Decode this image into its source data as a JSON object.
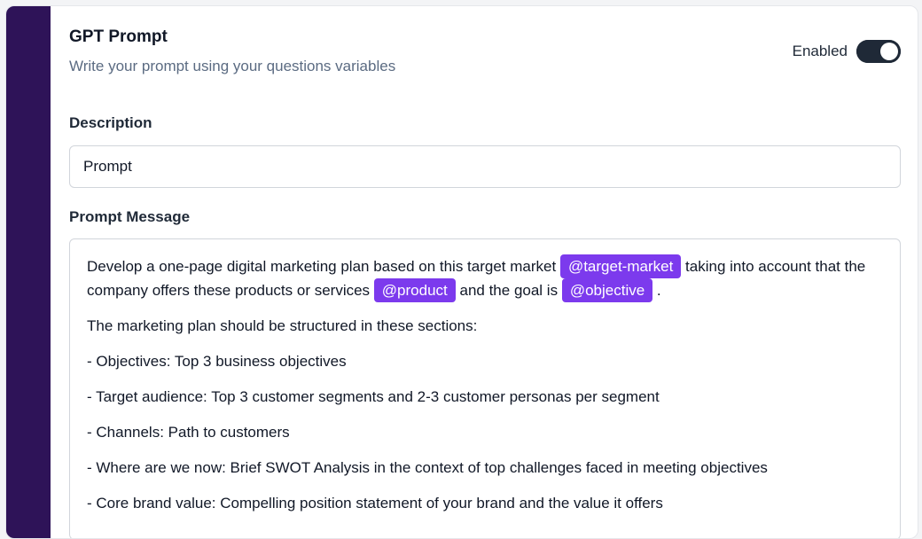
{
  "header": {
    "title": "GPT Prompt",
    "subtitle": "Write your prompt using your questions variables",
    "toggle_label": "Enabled",
    "toggle_state": true
  },
  "description": {
    "label": "Description",
    "value": "Prompt"
  },
  "prompt_message": {
    "label": "Prompt Message",
    "intro": {
      "part1": "Develop a one-page digital marketing plan based on this target market",
      "tag1": "@target-market",
      "part2": "taking into account that the company offers these products or services",
      "tag2": "@product",
      "part3": "and the goal is",
      "tag3": "@objective",
      "part4": "."
    },
    "lines": [
      "The marketing plan should be structured in these sections:",
      "- Objectives: Top 3 business objectives",
      "- Target audience: Top 3 customer segments and 2-3 customer personas per segment",
      "- Channels: Path to customers",
      "- Where are we now: Brief SWOT Analysis in the context of top challenges faced in meeting objectives",
      "- Core brand value: Compelling position statement of your brand and the value it offers"
    ]
  },
  "colors": {
    "accent_bar": "#2e1358",
    "tag_bg": "#7c3aed",
    "toggle_on": "#1f2937"
  }
}
